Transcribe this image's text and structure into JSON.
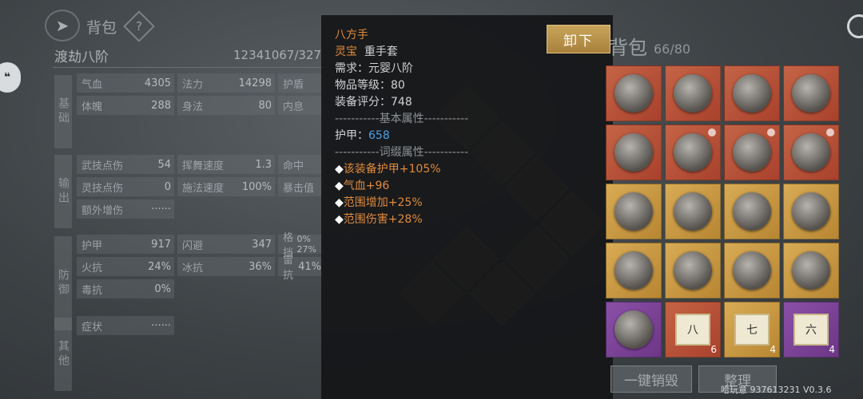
{
  "header": {
    "back_icon": "back-arrow-icon",
    "title": "背包",
    "help": "?",
    "rank": "渡劫八阶",
    "exp": "12341067/327"
  },
  "stats": {
    "basic": {
      "label": "基础",
      "cells": [
        {
          "k": "气血",
          "v": "4305"
        },
        {
          "k": "法力",
          "v": "14298"
        },
        {
          "k": "护盾",
          "v": ""
        },
        {
          "k": "体魄",
          "v": "288"
        },
        {
          "k": "身法",
          "v": "80"
        },
        {
          "k": "内息",
          "v": ""
        }
      ]
    },
    "output": {
      "label": "输出",
      "cells": [
        {
          "k": "武技点伤",
          "v": "54"
        },
        {
          "k": "挥舞速度",
          "v": "1.3"
        },
        {
          "k": "命中",
          "v": ""
        },
        {
          "k": "灵技点伤",
          "v": "0"
        },
        {
          "k": "施法速度",
          "v": "100%"
        },
        {
          "k": "暴击值",
          "v": ""
        },
        {
          "k": "额外增伤",
          "v": "······"
        }
      ]
    },
    "defense": {
      "label": "防御",
      "cells": [
        {
          "k": "护甲",
          "v": "917"
        },
        {
          "k": "闪避",
          "v": "347"
        },
        {
          "k": "格挡",
          "v": "0% 27%"
        },
        {
          "k": "火抗",
          "v": "24%"
        },
        {
          "k": "冰抗",
          "v": "36%"
        },
        {
          "k": "雷抗",
          "v": "41%"
        },
        {
          "k": "毒抗",
          "v": "0%"
        }
      ]
    },
    "other": {
      "label": "其他",
      "cells": [
        {
          "k": "症状",
          "v": "······"
        }
      ]
    }
  },
  "popup": {
    "name": "八方手",
    "quality": "灵宝",
    "type": "重手套",
    "requirement": "需求：元婴八阶",
    "item_level": "物品等级：80",
    "score": "装备评分：748",
    "base_sep": "-----------基本属性-----------",
    "armor_label": "护甲：",
    "armor_value": "658",
    "affix_sep": "-----------词缀属性-----------",
    "affixes": [
      "该装备护甲+105%",
      "气血+96",
      "范围增加+25%",
      "范围伤害+28%"
    ],
    "unequip_label": "卸下"
  },
  "bag": {
    "title": "背包",
    "count": "66/80",
    "slots": [
      {
        "rarity": "red",
        "icon": "bracelet-icon"
      },
      {
        "rarity": "red",
        "icon": "helmet-icon"
      },
      {
        "rarity": "red",
        "icon": "claw-icon"
      },
      {
        "rarity": "red",
        "icon": "bracelet-icon"
      },
      {
        "rarity": "red",
        "icon": "ring-icon"
      },
      {
        "rarity": "red",
        "icon": "lantern-icon"
      },
      {
        "rarity": "red",
        "icon": "fan-icon"
      },
      {
        "rarity": "red",
        "icon": "fan-icon"
      },
      {
        "rarity": "gold",
        "icon": "ring-icon"
      },
      {
        "rarity": "gold",
        "icon": "boots-icon"
      },
      {
        "rarity": "gold",
        "icon": "armor-icon"
      },
      {
        "rarity": "gold",
        "icon": "armor-icon"
      },
      {
        "rarity": "gold",
        "icon": "helmet-icon"
      },
      {
        "rarity": "gold",
        "icon": "bow-icon"
      },
      {
        "rarity": "gold",
        "icon": "staff-icon"
      },
      {
        "rarity": "gold",
        "icon": "sword-icon"
      },
      {
        "rarity": "purple",
        "icon": "claw-icon"
      },
      {
        "rarity": "red",
        "icon": "scroll-icon",
        "text": "八",
        "qty": "6"
      },
      {
        "rarity": "gold",
        "icon": "scroll-icon",
        "text": "七",
        "qty": "4"
      },
      {
        "rarity": "purple",
        "icon": "scroll-icon",
        "text": "六",
        "qty": "4"
      }
    ],
    "destroy_label": "一键销毁",
    "sort_label": "整理"
  },
  "footer": {
    "version": "哈玩意 937613231 V0.3.6"
  }
}
